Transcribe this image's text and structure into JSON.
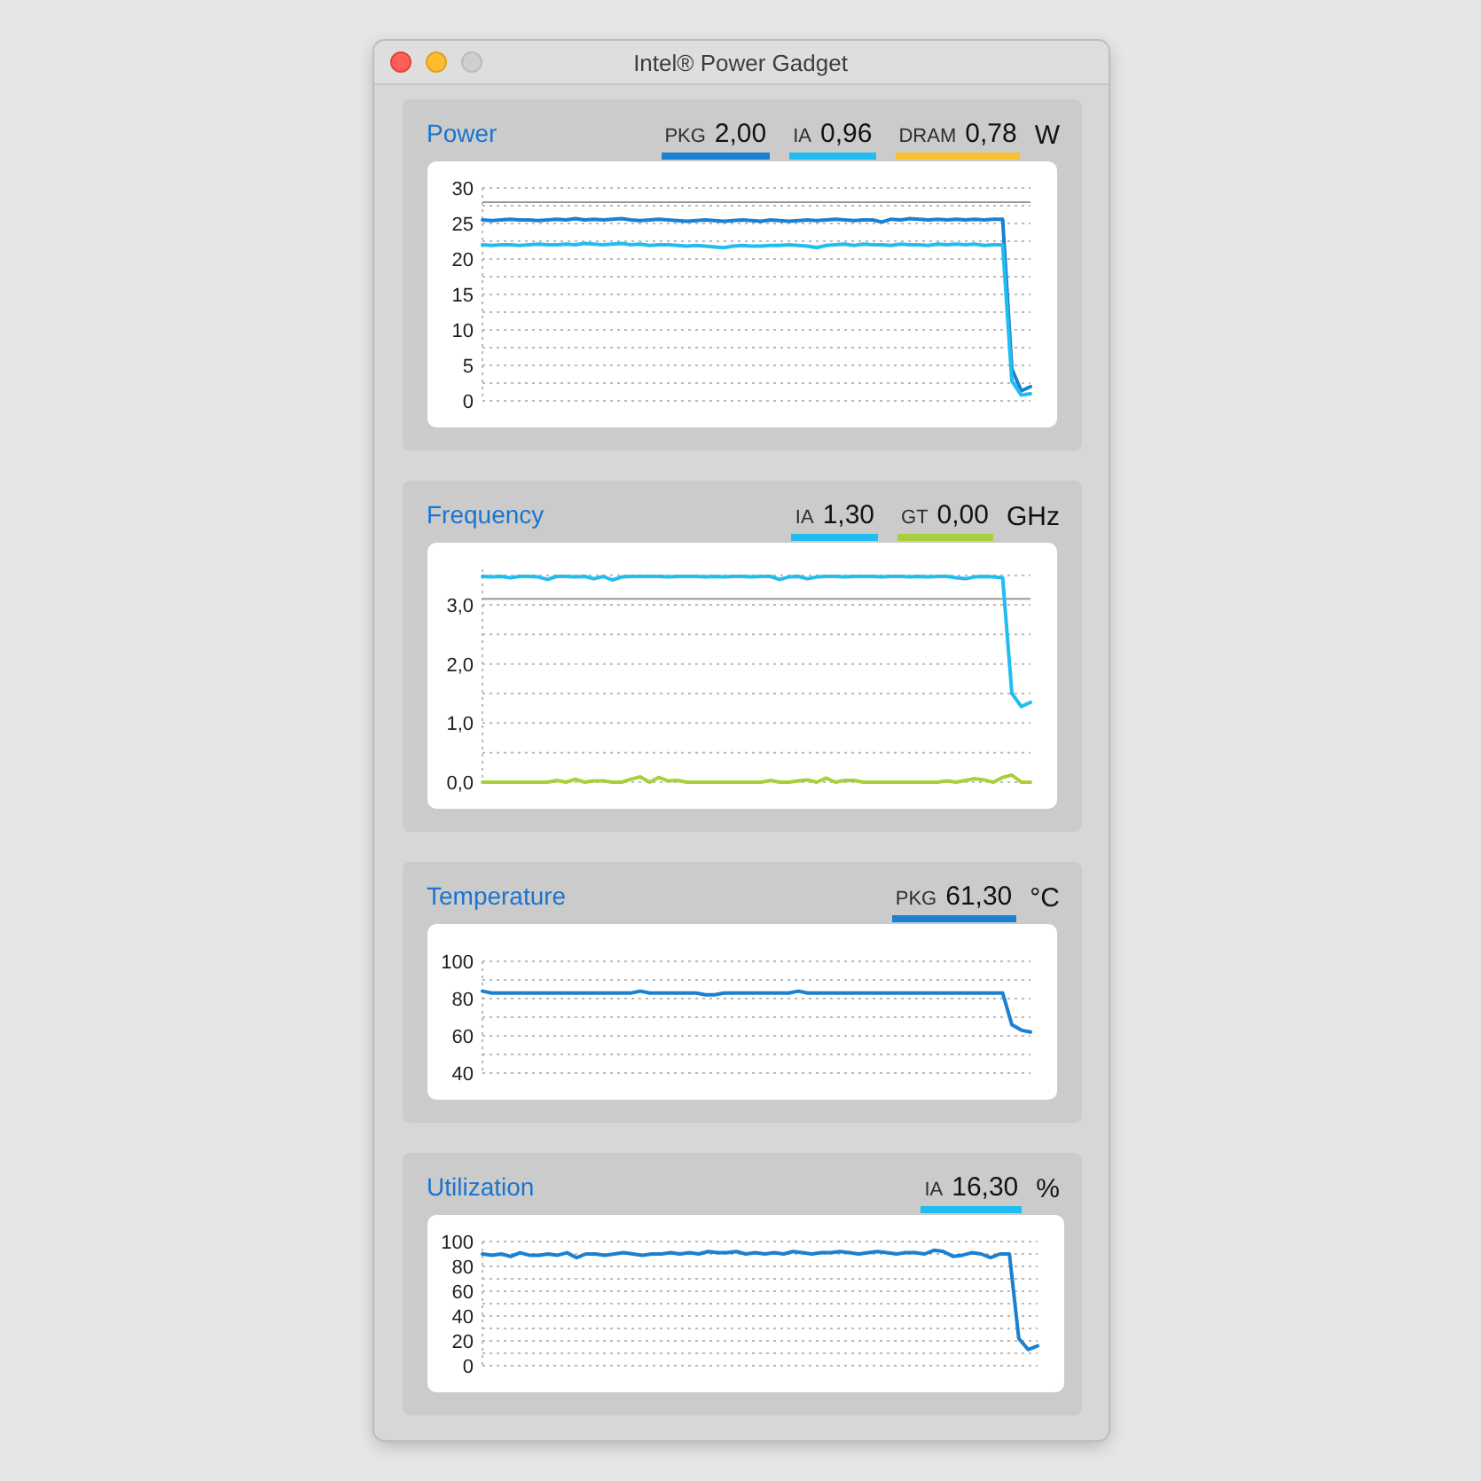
{
  "window": {
    "title": "Intel® Power Gadget",
    "controls": [
      {
        "kind": "close",
        "disabled": false
      },
      {
        "kind": "minimize",
        "disabled": false
      },
      {
        "kind": "zoom",
        "disabled": true
      }
    ]
  },
  "sections": [
    {
      "title": "Power",
      "legend": [
        {
          "label": "PKG",
          "value": "2,00",
          "color": "#1a80d2"
        },
        {
          "label": "IA",
          "value": "0,96",
          "color": "#22bdf0"
        },
        {
          "label": "DRAM",
          "value": "0,78",
          "color": "#f8c22e"
        }
      ],
      "unit": "W",
      "chart_data": {
        "type": "line",
        "ylim": [
          0,
          30
        ],
        "yticks": [
          0,
          5,
          10,
          15,
          20,
          25,
          30
        ],
        "grid": true,
        "series": [
          {
            "color": "#1a80d2",
            "values": [
              25.5,
              25.4,
              25.5,
              25.6,
              25.5,
              25.5,
              25.4,
              25.5,
              25.6,
              25.5,
              25.7,
              25.5,
              25.6,
              25.5,
              25.6,
              25.7,
              25.5,
              25.4,
              25.5,
              25.6,
              25.5,
              25.4,
              25.3,
              25.4,
              25.5,
              25.4,
              25.3,
              25.4,
              25.5,
              25.4,
              25.3,
              25.5,
              25.4,
              25.3,
              25.4,
              25.5,
              25.4,
              25.5,
              25.6,
              25.5,
              25.4,
              25.5,
              25.5,
              25.2,
              25.6,
              25.5,
              25.7,
              25.6,
              25.5,
              25.6,
              25.5,
              25.6,
              25.5,
              25.6,
              25.5,
              25.6,
              25.6,
              4.5,
              1.4,
              2.0
            ]
          },
          {
            "color": "#22bdf0",
            "values": [
              22.0,
              21.9,
              22.0,
              22.0,
              21.9,
              22.0,
              22.1,
              22.0,
              22.0,
              22.1,
              22.0,
              22.2,
              22.1,
              22.0,
              22.1,
              22.2,
              22.0,
              22.1,
              21.9,
              22.0,
              22.0,
              21.9,
              21.8,
              21.9,
              21.8,
              21.7,
              21.6,
              21.8,
              21.9,
              21.8,
              21.8,
              21.9,
              21.9,
              22.0,
              21.9,
              21.8,
              21.6,
              21.9,
              22.0,
              22.1,
              21.9,
              22.1,
              22.0,
              22.0,
              21.9,
              22.1,
              22.0,
              22.0,
              21.9,
              22.1,
              22.0,
              22.1,
              22.0,
              22.1,
              21.9,
              22.0,
              22.0,
              2.8,
              0.8,
              1.0
            ]
          }
        ],
        "ref_lines": [
          {
            "axis": "y",
            "value": 28
          }
        ]
      }
    },
    {
      "title": "Frequency",
      "legend": [
        {
          "label": "IA",
          "value": "1,30",
          "color": "#22bdf0"
        },
        {
          "label": "GT",
          "value": "0,00",
          "color": "#a9cf3a"
        }
      ],
      "unit": "GHz",
      "chart_data": {
        "type": "line",
        "ylim": [
          0,
          3.6
        ],
        "yticks": [
          {
            "value": 0,
            "label": "0,0"
          },
          {
            "value": 1,
            "label": "1,0"
          },
          {
            "value": 2,
            "label": "2,0"
          },
          {
            "value": 3,
            "label": "3,0"
          }
        ],
        "grid": true,
        "series": [
          {
            "color": "#22bdf0",
            "values": [
              3.48,
              3.47,
              3.48,
              3.46,
              3.48,
              3.48,
              3.47,
              3.43,
              3.48,
              3.48,
              3.47,
              3.48,
              3.44,
              3.48,
              3.42,
              3.47,
              3.48,
              3.48,
              3.48,
              3.48,
              3.47,
              3.48,
              3.48,
              3.48,
              3.47,
              3.48,
              3.47,
              3.48,
              3.48,
              3.47,
              3.48,
              3.48,
              3.43,
              3.47,
              3.48,
              3.44,
              3.47,
              3.48,
              3.48,
              3.47,
              3.48,
              3.48,
              3.48,
              3.47,
              3.48,
              3.48,
              3.47,
              3.48,
              3.47,
              3.48,
              3.48,
              3.46,
              3.44,
              3.47,
              3.48,
              3.47,
              3.46,
              1.5,
              1.28,
              1.35
            ]
          },
          {
            "color": "#a9cf3a",
            "values": [
              0,
              0,
              0,
              0,
              0,
              0,
              0,
              0,
              0.03,
              0,
              0.05,
              0,
              0.02,
              0.02,
              0,
              0,
              0.05,
              0.09,
              0,
              0.08,
              0.02,
              0.03,
              0,
              0,
              0,
              0,
              0,
              0,
              0,
              0,
              0,
              0.03,
              0,
              0,
              0.02,
              0.04,
              0,
              0.07,
              0,
              0.03,
              0.03,
              0,
              0,
              0,
              0,
              0,
              0,
              0,
              0,
              0,
              0.02,
              0,
              0.03,
              0.06,
              0.04,
              0,
              0.08,
              0.12,
              0,
              0
            ]
          }
        ],
        "ref_lines": [
          {
            "axis": "y",
            "value": 3.1
          }
        ]
      }
    },
    {
      "title": "Temperature",
      "legend": [
        {
          "label": "PKG",
          "value": "61,30",
          "color": "#1a80d2"
        }
      ],
      "unit": "°C",
      "chart_data": {
        "type": "line",
        "ylim": [
          40,
          100
        ],
        "yticks": [
          40,
          60,
          80,
          100
        ],
        "grid": true,
        "series": [
          {
            "color": "#1a80d2",
            "values": [
              84,
              83,
              83,
              83,
              83,
              83,
              83,
              83,
              83,
              83,
              83,
              83,
              83,
              83,
              83,
              83,
              83,
              84,
              83,
              83,
              83,
              83,
              83,
              83,
              82,
              82,
              83,
              83,
              83,
              83,
              83,
              83,
              83,
              83,
              84,
              83,
              83,
              83,
              83,
              83,
              83,
              83,
              83,
              83,
              83,
              83,
              83,
              83,
              83,
              83,
              83,
              83,
              83,
              83,
              83,
              83,
              83,
              66,
              63,
              62
            ]
          }
        ]
      }
    },
    {
      "title": "Utilization",
      "legend": [
        {
          "label": "IA",
          "value": "16,30",
          "color": "#22bdf0"
        }
      ],
      "unit": "%",
      "chart_data": {
        "type": "line",
        "ylim": [
          0,
          100
        ],
        "yticks": [
          0,
          20,
          40,
          60,
          80,
          100
        ],
        "grid": true,
        "series": [
          {
            "color": "#1a80d2",
            "values": [
              90,
              89,
              90,
              88,
              91,
              89,
              89,
              90,
              89,
              91,
              87,
              90,
              90,
              89,
              90,
              91,
              90,
              89,
              90,
              90,
              91,
              90,
              91,
              90,
              92,
              91,
              91,
              92,
              90,
              91,
              90,
              91,
              90,
              92,
              91,
              90,
              91,
              91,
              92,
              91,
              90,
              91,
              92,
              91,
              90,
              91,
              91,
              90,
              93,
              92,
              88,
              89,
              91,
              90,
              87,
              90,
              90,
              22,
              13,
              16
            ]
          }
        ]
      }
    }
  ]
}
